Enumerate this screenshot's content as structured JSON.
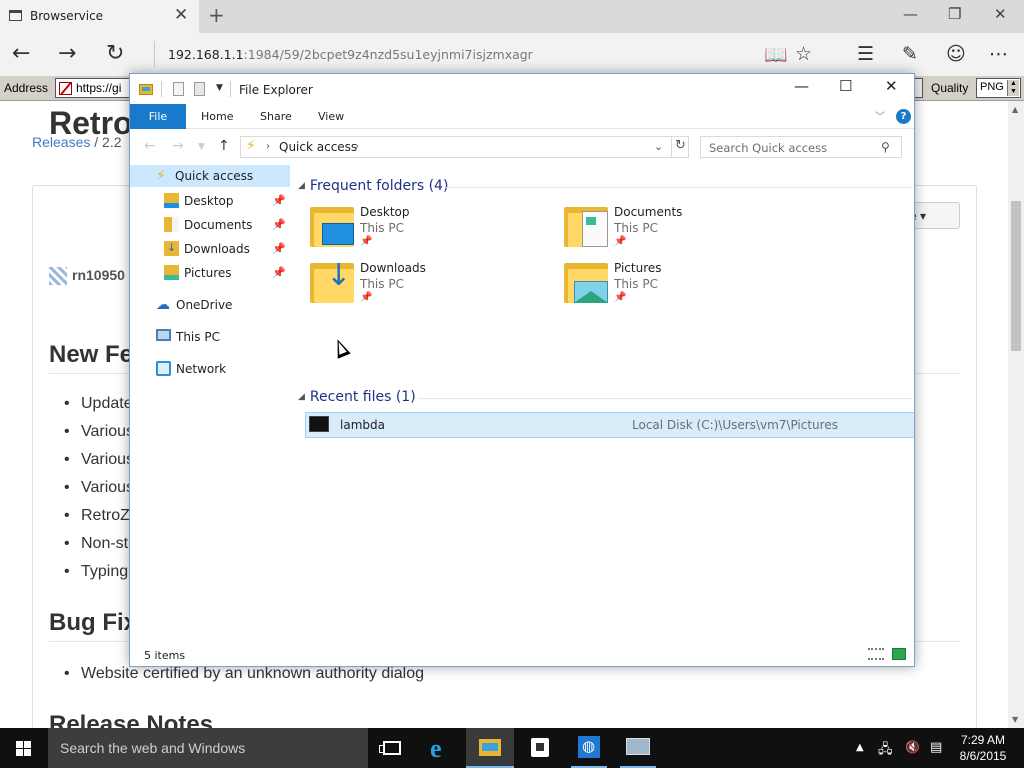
{
  "browser": {
    "tab_title": "Browservice",
    "url_host": "192.168.1.1",
    "url_rest": ":1984/59/2bcpet9z4nzd5su1eyjnmi7isjzmxagr"
  },
  "toolbar": {
    "address_label": "Address",
    "address_value": "https://gi",
    "quality_label": "Quality",
    "quality_value": "PNG"
  },
  "page": {
    "breadcrumb_link": "Releases",
    "breadcrumb_rest": " / 2.2",
    "title": "Retro",
    "author": "rn10950",
    "more_label": "re ▾",
    "new_features_heading": "New Fe",
    "features": [
      "Update",
      "Various",
      "Various",
      "Various",
      "RetroZ",
      "Non-st",
      "Typing"
    ],
    "bug_fixes_heading": "Bug Fix",
    "bug_fixes": [
      "Website certified by an unknown authority dialog"
    ],
    "release_notes_heading": "Release Notes"
  },
  "explorer": {
    "title": "File Explorer",
    "ribbon_tabs": [
      "File",
      "Home",
      "Share",
      "View"
    ],
    "address_location": "Quick access",
    "search_placeholder": "Search Quick access",
    "nav_pane": {
      "quick_access": "Quick access",
      "pinned": [
        "Desktop",
        "Documents",
        "Downloads",
        "Pictures"
      ],
      "onedrive": "OneDrive",
      "this_pc": "This PC",
      "network": "Network"
    },
    "frequent_heading": "Frequent folders (4)",
    "frequent_folders": [
      {
        "name": "Desktop",
        "location": "This PC"
      },
      {
        "name": "Documents",
        "location": "This PC"
      },
      {
        "name": "Downloads",
        "location": "This PC"
      },
      {
        "name": "Pictures",
        "location": "This PC"
      }
    ],
    "recent_heading": "Recent files (1)",
    "recent_files": [
      {
        "name": "lambda",
        "path": "Local Disk (C:)\\Users\\vm7\\Pictures"
      }
    ],
    "status_text": "5 items"
  },
  "taskbar": {
    "search_placeholder": "Search the web and Windows",
    "time": "7:29 AM",
    "date": "8/6/2015"
  },
  "colors": {
    "accent": "#1979ca",
    "selection": "#cce8ff",
    "folder": "#e8b632",
    "link": "#4078c0"
  }
}
